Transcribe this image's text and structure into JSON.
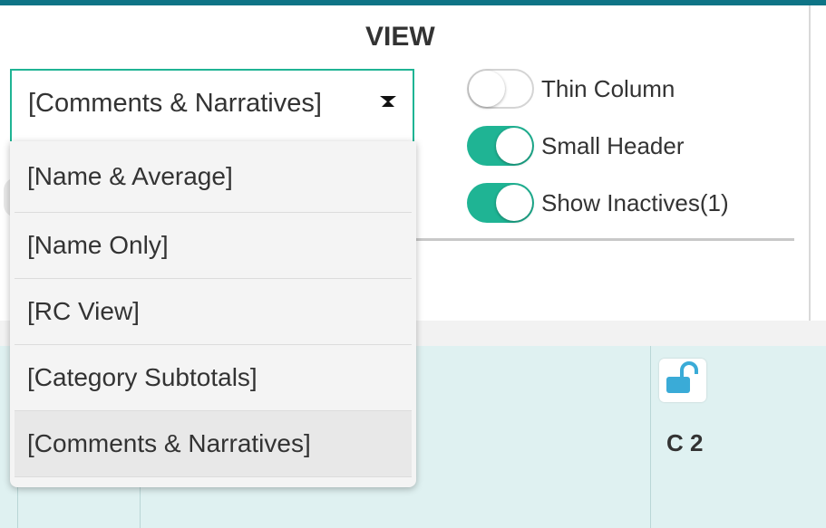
{
  "view": {
    "title": "VIEW",
    "select_value": "[Comments & Narratives]",
    "options": [
      {
        "label": "[Name & Average]",
        "selected": false
      },
      {
        "label": "[Name Only]",
        "selected": false
      },
      {
        "label": "[RC View]",
        "selected": false
      },
      {
        "label": "[Category Subtotals]",
        "selected": false
      },
      {
        "label": "[Comments & Narratives]",
        "selected": true
      }
    ],
    "toggles": [
      {
        "label": "Thin Column",
        "on": false
      },
      {
        "label": "Small Header",
        "on": true
      },
      {
        "label": "Show Inactives(1)",
        "on": true
      }
    ]
  },
  "grid": {
    "column_label": "C 2",
    "lock_icon": "unlock-icon",
    "lock_color": "#3aabd7"
  },
  "colors": {
    "accent": "#1fb494",
    "topbar": "#0e7486",
    "grid_bg": "#dff1f1"
  }
}
